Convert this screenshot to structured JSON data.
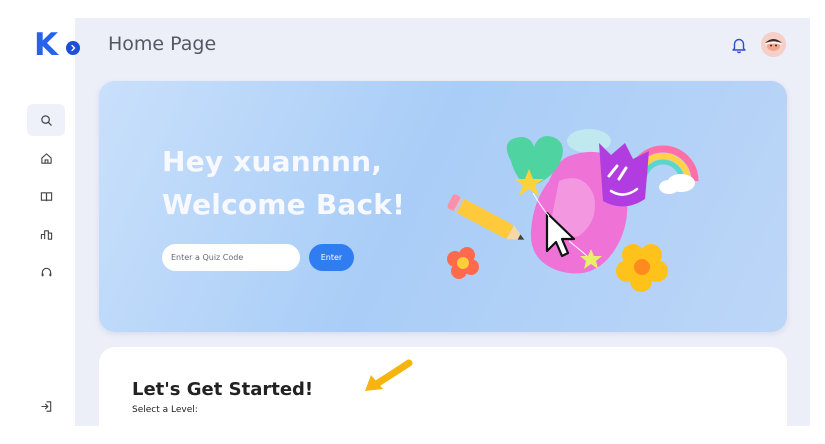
{
  "app": {
    "logo_letter": "K"
  },
  "header": {
    "title": "Home Page"
  },
  "sidebar": {
    "items": [
      {
        "icon": "search-icon",
        "active": true
      },
      {
        "icon": "home-icon",
        "active": false
      },
      {
        "icon": "book-icon",
        "active": false
      },
      {
        "icon": "leaderboard-icon",
        "active": false
      },
      {
        "icon": "headset-icon",
        "active": false
      }
    ],
    "logout_icon": "logout-icon"
  },
  "hero": {
    "greeting": "Hey xuannnn,",
    "welcome": "Welcome Back!",
    "quiz_placeholder": "Enter a Quiz Code",
    "enter_label": "Enter"
  },
  "start_card": {
    "title": "Let's Get Started!",
    "subtitle": "Select a Level:"
  },
  "colors": {
    "brand": "#2563eb",
    "enter_button": "#2f7df0",
    "background": "#eceef8",
    "arrow": "#f5b50e"
  }
}
